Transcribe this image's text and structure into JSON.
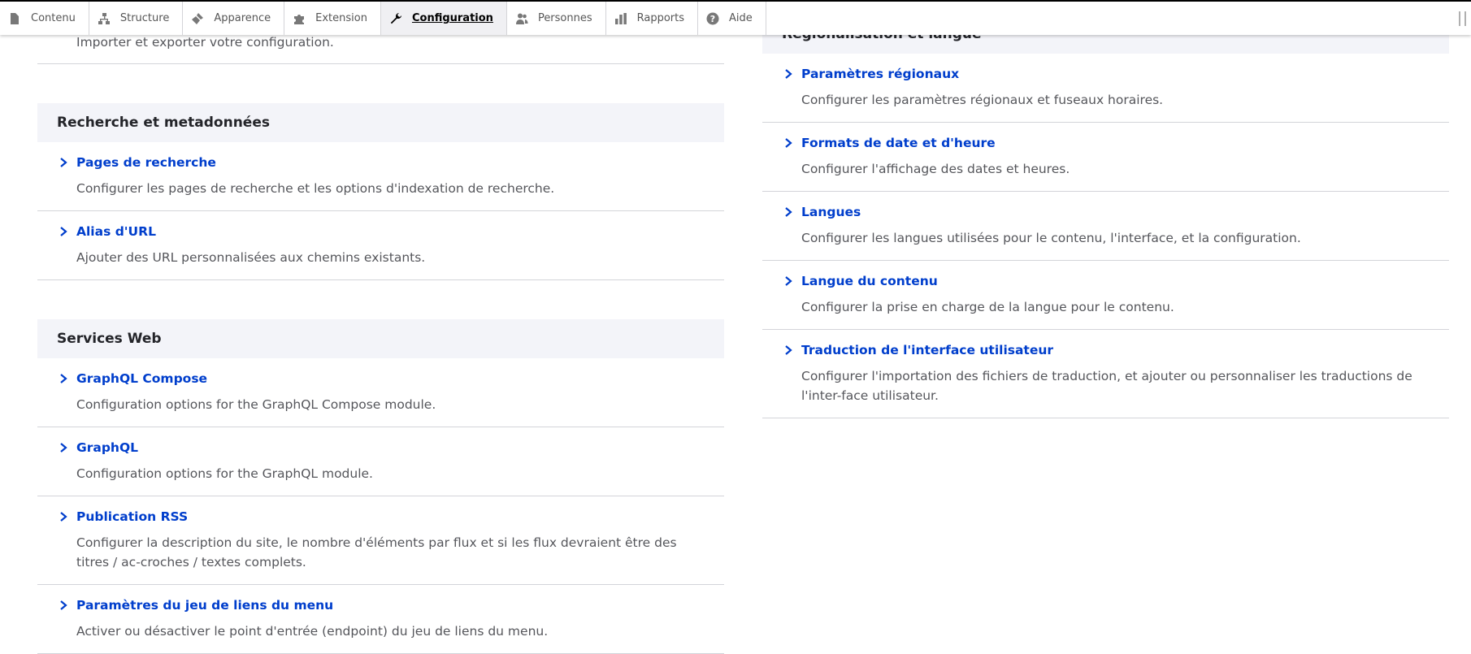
{
  "toolbar": {
    "items": [
      {
        "label": "Contenu",
        "icon": "file-icon"
      },
      {
        "label": "Structure",
        "icon": "sitemap-icon"
      },
      {
        "label": "Apparence",
        "icon": "paintbrush-icon"
      },
      {
        "label": "Extension",
        "icon": "puzzle-icon"
      },
      {
        "label": "Configuration",
        "icon": "wrench-icon"
      },
      {
        "label": "Personnes",
        "icon": "people-icon"
      },
      {
        "label": "Rapports",
        "icon": "bar-chart-icon"
      },
      {
        "label": "Aide",
        "icon": "help-icon"
      }
    ],
    "active": "Configuration"
  },
  "left": {
    "top_item_desc": "Importer et exporter votre configuration.",
    "search": {
      "title": "Recherche et metadonnées",
      "items": [
        {
          "title": "Pages de recherche",
          "desc": "Configurer les pages de recherche et les options d'indexation de recherche."
        },
        {
          "title": "Alias d'URL",
          "desc": "Ajouter des URL personnalisées aux chemins existants."
        }
      ]
    },
    "web": {
      "title": "Services Web",
      "items": [
        {
          "title": "GraphQL Compose",
          "desc": "Configuration options for the GraphQL Compose module."
        },
        {
          "title": "GraphQL",
          "desc": "Configuration options for the GraphQL module."
        },
        {
          "title": "Publication RSS",
          "desc": "Configurer la description du site, le nombre d'éléments par flux et si les flux devraient être des titres / ac-croches / textes complets."
        },
        {
          "title": "Paramètres du jeu de liens du menu",
          "desc": "Activer ou désactiver le point d'entrée (endpoint) du jeu de liens du menu."
        }
      ]
    }
  },
  "right": {
    "regional": {
      "title": "Régionalisation et langue",
      "items": [
        {
          "title": "Paramètres régionaux",
          "desc": "Configurer les paramètres régionaux et fuseaux horaires."
        },
        {
          "title": "Formats de date et d'heure",
          "desc": "Configurer l'affichage des dates et heures."
        },
        {
          "title": "Langues",
          "desc": "Configurer les langues utilisées pour le contenu, l'interface, et la configuration."
        },
        {
          "title": "Langue du contenu",
          "desc": "Configurer la prise en charge de la langue pour le contenu."
        },
        {
          "title": "Traduction de l'interface utilisateur",
          "desc": "Configurer l'importation des fichiers de traduction, et ajouter ou personnaliser les traductions de l'inter-face utilisateur."
        }
      ]
    }
  },
  "colors": {
    "link": "#003ecc",
    "panel_header_bg": "#f3f4f9",
    "text": "#55565b"
  }
}
